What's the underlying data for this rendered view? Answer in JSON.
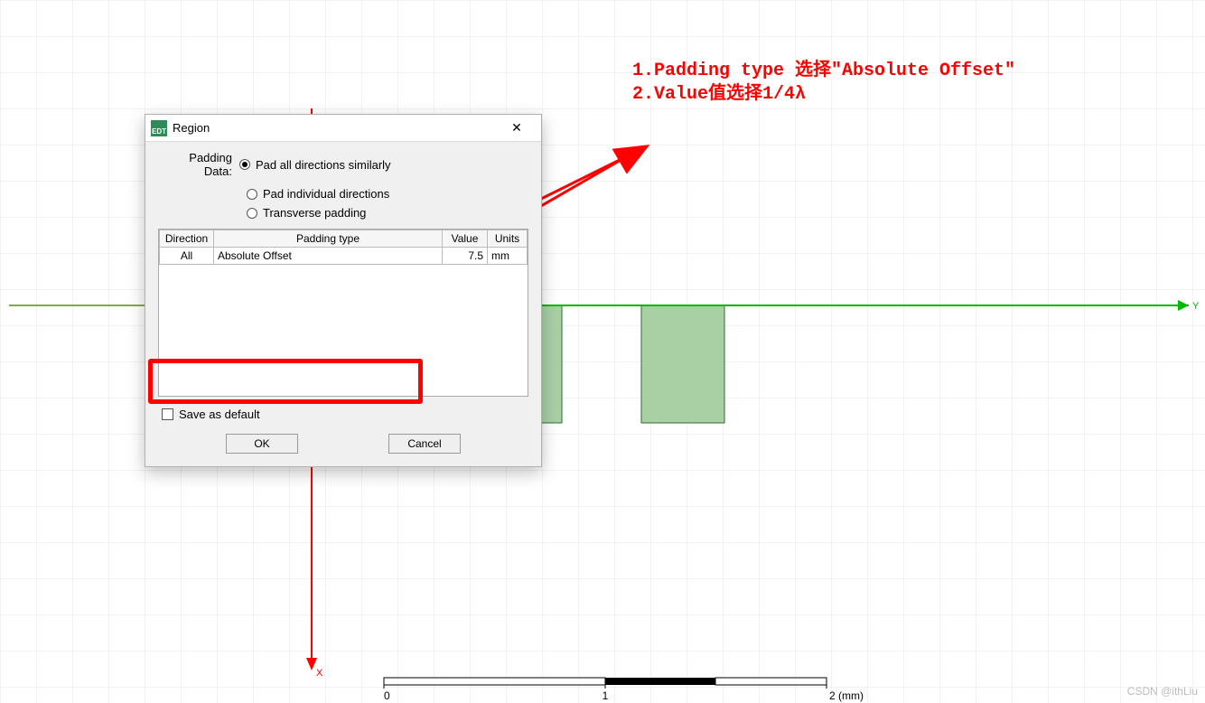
{
  "dialog": {
    "title": "Region",
    "app_icon_text": "EDT",
    "padding_label": "Padding Data:",
    "radios": {
      "opt1": "Pad all directions similarly",
      "opt2": "Pad individual directions",
      "opt3": "Transverse padding"
    },
    "headers": {
      "direction": "Direction",
      "padding_type": "Padding type",
      "value": "Value",
      "units": "Units"
    },
    "row": {
      "direction": "All",
      "padding_type": "Absolute Offset",
      "value": "7.5",
      "units": "mm"
    },
    "save_default": "Save as default",
    "ok": "OK",
    "cancel": "Cancel"
  },
  "annotations": {
    "line1": "1.Padding type 选择\"Absolute Offset\"",
    "line2": "2.Value值选择1/4λ"
  },
  "canvas": {
    "axis_y_label": "Y",
    "axis_x_label": "X",
    "scale_ticks": [
      "0",
      "1",
      "2 (mm)"
    ]
  },
  "watermark": "CSDN @ithLiu"
}
